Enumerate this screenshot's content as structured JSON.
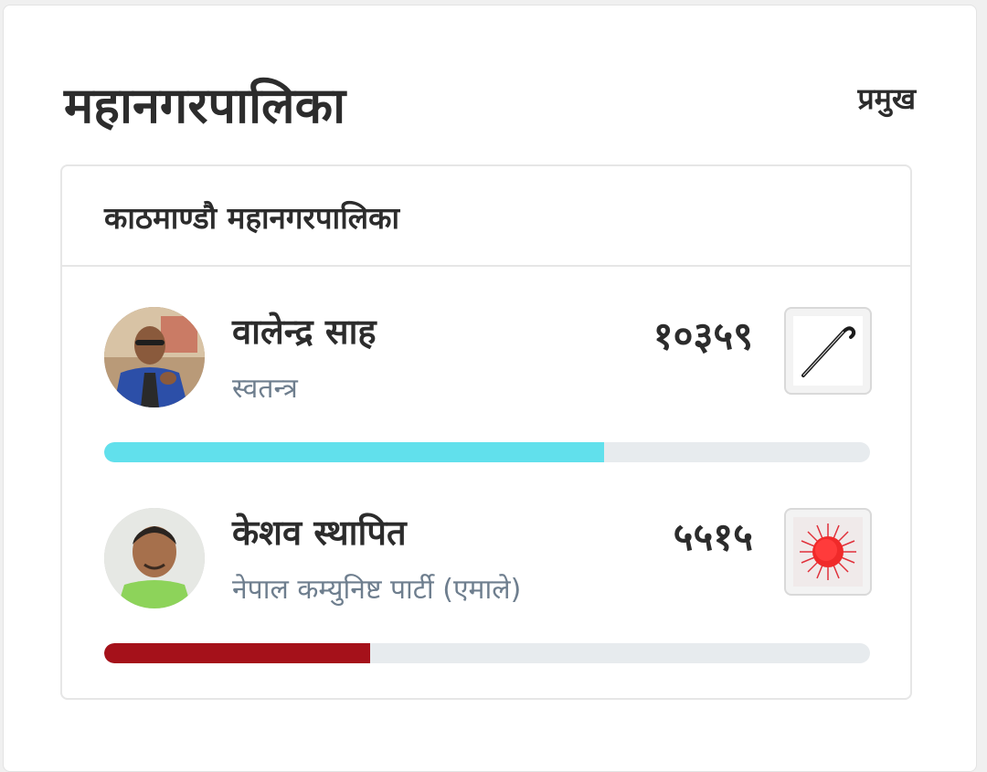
{
  "header": {
    "title": "महानगरपालिका",
    "link_label": "प्रमुख"
  },
  "municipality": {
    "name": "काठमाण्डौ महानगरपालिका"
  },
  "candidates": [
    {
      "name": "वालेन्द्र साह",
      "party": "स्वतन्त्र",
      "votes": "१०३५९",
      "symbol_icon": "walking-stick-icon",
      "bar_color": "#61e0ec",
      "vote_share": 0.653
    },
    {
      "name": "केशव स्थापित",
      "party": "नेपाल कम्युनिष्ट पार्टी (एमाले)",
      "votes": "५५१५",
      "symbol_icon": "sun-icon",
      "bar_color": "#a5111a",
      "vote_share": 0.347
    }
  ],
  "colors": {
    "track": "#e7ebee",
    "text_dark": "#2c2c2c",
    "text_muted": "#6e7e8e"
  }
}
